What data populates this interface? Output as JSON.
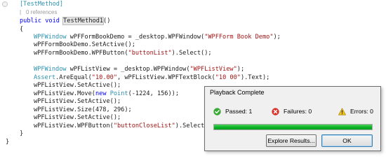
{
  "code": {
    "attribute_line": "[TestMethod]",
    "codelens": {
      "pipe": "|",
      "references": "0 references"
    },
    "lines": [
      {
        "tokens": [
          {
            "t": "public",
            "c": "kw"
          },
          {
            "t": " "
          },
          {
            "t": "void",
            "c": "kw"
          },
          {
            "t": " "
          },
          {
            "t": "TestMethod1",
            "c": "hl"
          },
          {
            "t": "()"
          }
        ]
      },
      {
        "tokens": [
          {
            "t": "{"
          }
        ]
      },
      {
        "tokens": [
          {
            "t": "WPFWindow",
            "c": "ty"
          },
          {
            "t": " wPFFormBookDemo = _desktop.WPFWindow("
          },
          {
            "t": "\"WPFForm Book Demo\"",
            "c": "str"
          },
          {
            "t": ");"
          }
        ]
      },
      {
        "tokens": [
          {
            "t": "wPFFormBookDemo.SetActive();"
          }
        ]
      },
      {
        "tokens": [
          {
            "t": "wPFFormBookDemo.WPFButton("
          },
          {
            "t": "\"buttonList\"",
            "c": "str"
          },
          {
            "t": ").Select();"
          }
        ]
      },
      {
        "tokens": []
      },
      {
        "tokens": [
          {
            "t": "WPFWindow",
            "c": "ty"
          },
          {
            "t": " wPFListView = _desktop.WPFWindow("
          },
          {
            "t": "\"WPFListView\"",
            "c": "str"
          },
          {
            "t": ");"
          }
        ]
      },
      {
        "tokens": [
          {
            "t": "Assert",
            "c": "ty"
          },
          {
            "t": ".AreEqual("
          },
          {
            "t": "\"10.00\"",
            "c": "str"
          },
          {
            "t": ", wPFListView.WPFTextBlock("
          },
          {
            "t": "\"10 00\"",
            "c": "str"
          },
          {
            "t": ").Text);"
          }
        ]
      },
      {
        "tokens": [
          {
            "t": "wPFListView.SetActive();"
          }
        ]
      },
      {
        "tokens": [
          {
            "t": "wPFListView.Move("
          },
          {
            "t": "new",
            "c": "kw"
          },
          {
            "t": " "
          },
          {
            "t": "Point",
            "c": "ty"
          },
          {
            "t": "(-1224, 156));"
          }
        ]
      },
      {
        "tokens": [
          {
            "t": "wPFListView.SetActive();"
          }
        ]
      },
      {
        "tokens": [
          {
            "t": "wPFListView.Size(478, 296);"
          }
        ]
      },
      {
        "tokens": [
          {
            "t": "wPFListView.SetActive();"
          }
        ]
      },
      {
        "tokens": [
          {
            "t": "wPFListView.WPFButton("
          },
          {
            "t": "\"buttonCloseList\"",
            "c": "str"
          },
          {
            "t": ").Select();"
          }
        ]
      },
      {
        "tokens": [
          {
            "t": "}"
          }
        ]
      },
      {
        "tokens": [
          {
            "t": "}"
          }
        ]
      }
    ]
  },
  "dialog": {
    "title": "Playback Complete",
    "passed_label": "Passed: 1",
    "failures_label": "Failures: 0",
    "errors_label": "Errors: 0",
    "progress": 1.0,
    "colors": {
      "progress": "#06b025",
      "passed": "#3aa935",
      "failure": "#d9342b",
      "warning": "#f2c31a"
    },
    "icons": {
      "passed": "check-circle-icon",
      "failures": "error-x-icon",
      "errors": "warning-triangle-icon"
    },
    "explore_button": "Explore Results...",
    "ok_button": "OK"
  }
}
